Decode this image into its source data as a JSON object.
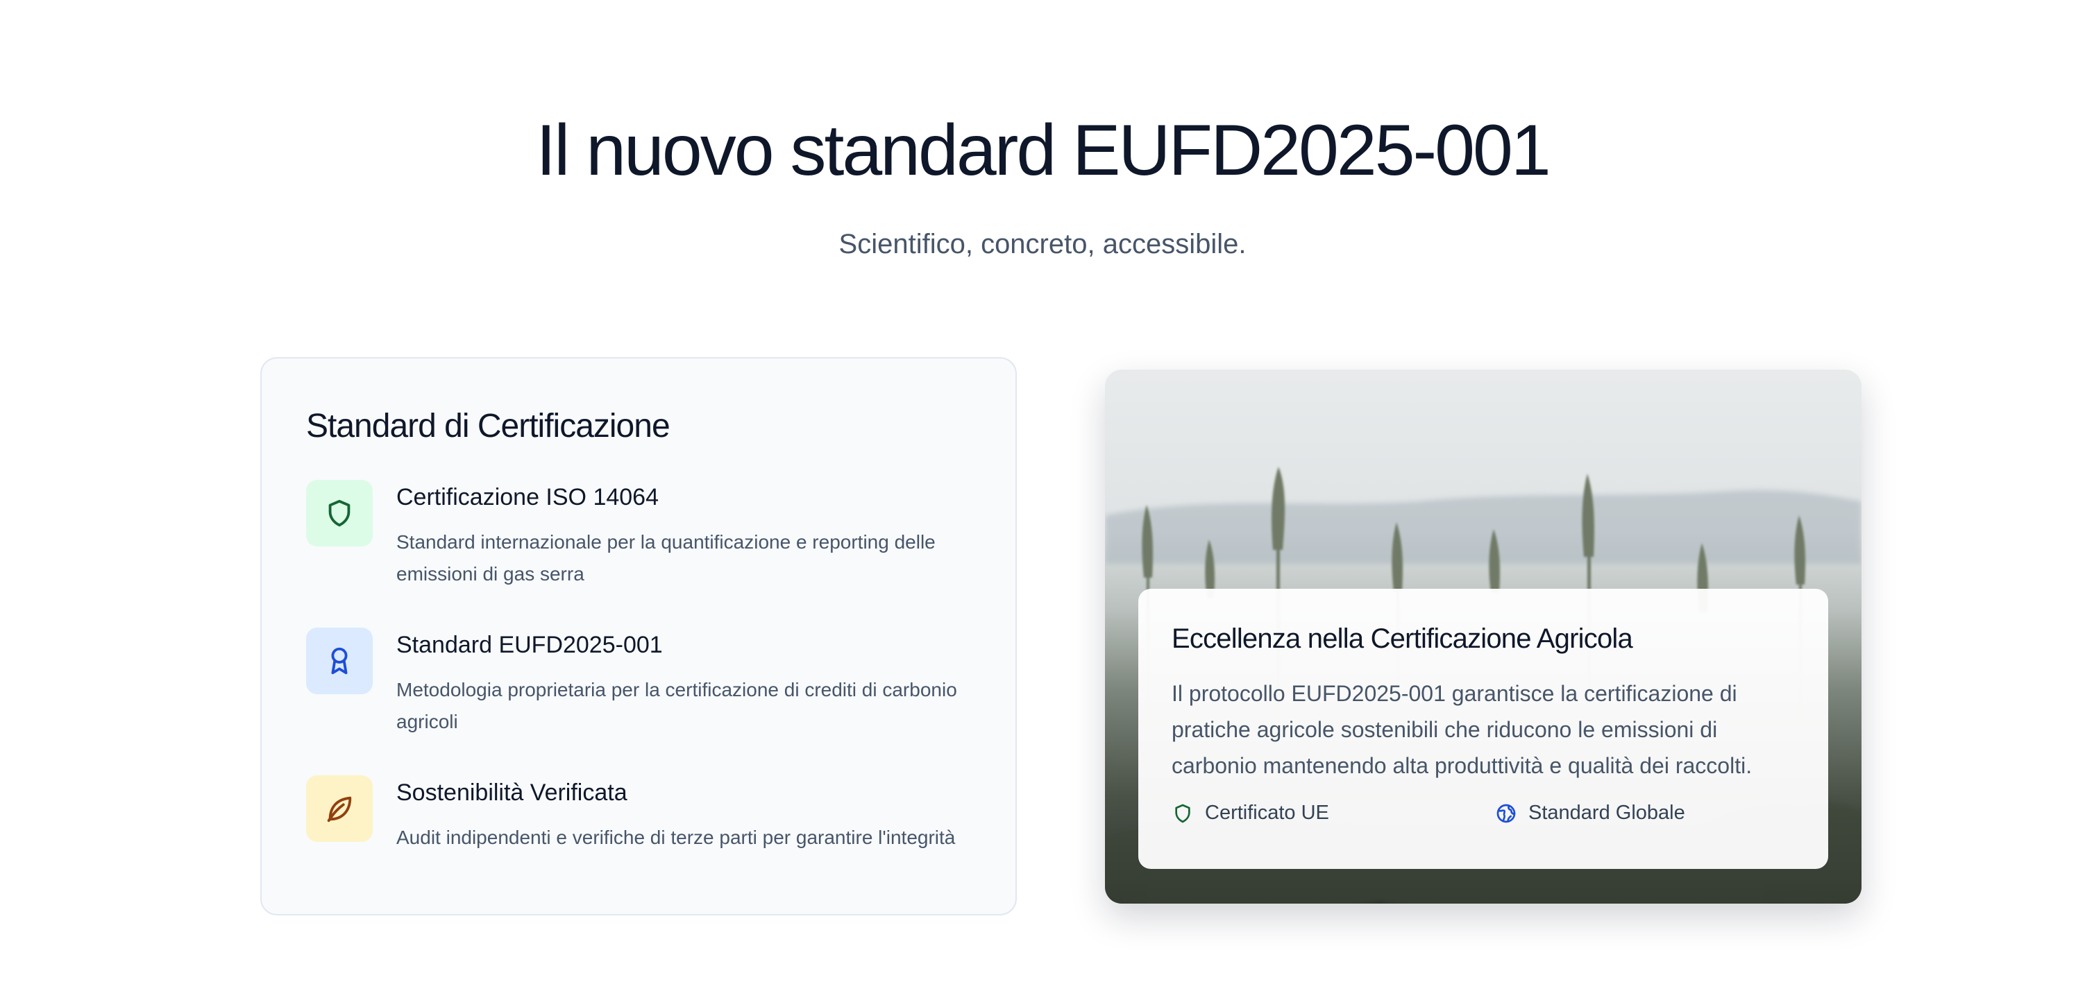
{
  "hero": {
    "title": "Il nuovo standard EUFD2025-001",
    "subtitle": "Scientifico, concreto, accessibile."
  },
  "certification_card": {
    "title": "Standard di Certificazione",
    "features": [
      {
        "title": "Certificazione ISO 14064",
        "description": "Standard internazionale per la quantificazione e reporting delle emissioni di gas serra",
        "icon": "shield-icon",
        "icon_bg": "#dcfce7",
        "icon_color": "#166534"
      },
      {
        "title": "Standard EUFD2025-001",
        "description": "Metodologia proprietaria per la certificazione di crediti di carbonio agricoli",
        "icon": "award-icon",
        "icon_bg": "#dbeafe",
        "icon_color": "#1d4ed8"
      },
      {
        "title": "Sostenibilità Verificata",
        "description": "Audit indipendenti e verifiche di terze parti per garantire l'integrità",
        "icon": "leaf-icon",
        "icon_bg": "#fef3c7",
        "icon_color": "#92400e"
      }
    ]
  },
  "image_card": {
    "title": "Eccellenza nella Certificazione Agricola",
    "description": "Il protocollo EUFD2025-001 garantisce la certificazione di pratiche agricole sostenibili che riducono le emissioni di carbonio mantenendo alta produttività e qualità dei raccolti.",
    "badges": [
      {
        "label": "Certificato UE",
        "icon": "shield-icon",
        "color": "#166534"
      },
      {
        "label": "Standard Globale",
        "icon": "globe-icon",
        "color": "#1d4ed8"
      }
    ]
  }
}
